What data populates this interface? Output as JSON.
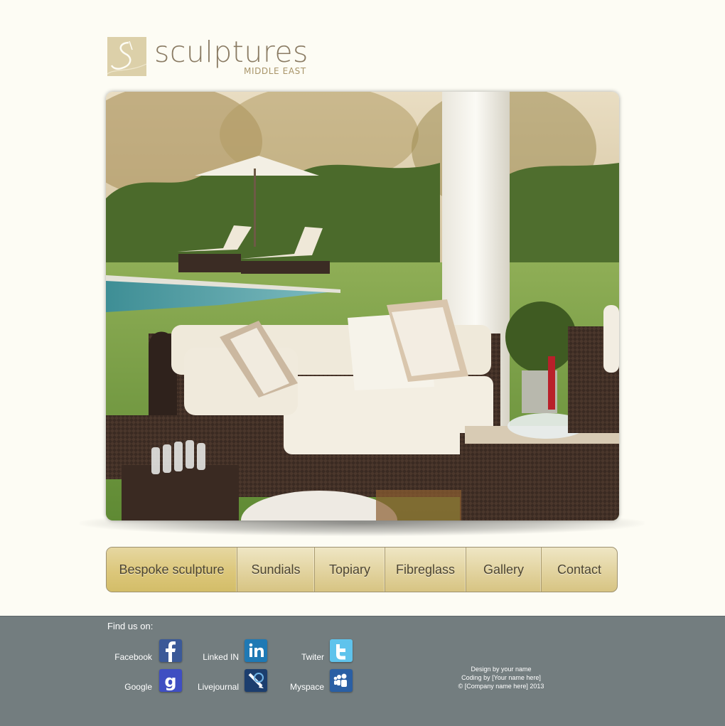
{
  "logo": {
    "word": "sculptures",
    "sub": "MIDDLE EAST"
  },
  "hero": {
    "image": "outdoor-patio-wicker-sofa-photo"
  },
  "nav": {
    "items": [
      {
        "label": "Bespoke sculpture"
      },
      {
        "label": "Sundials"
      },
      {
        "label": "Topiary"
      },
      {
        "label": "Fibreglass"
      },
      {
        "label": "Gallery"
      },
      {
        "label": "Contact"
      }
    ]
  },
  "footer": {
    "find_us": "Find us on:",
    "social": [
      {
        "label": "Facebook",
        "icon": "facebook-icon"
      },
      {
        "label": "Linked IN",
        "icon": "linkedin-icon"
      },
      {
        "label": "Twiter",
        "icon": "twitter-icon"
      },
      {
        "label": "Google",
        "icon": "google-icon"
      },
      {
        "label": "Livejournal",
        "icon": "livejournal-icon"
      },
      {
        "label": "Myspace",
        "icon": "myspace-icon"
      }
    ],
    "credits": {
      "line1": "Design by  your name",
      "line2": "Coding by [Your name here]",
      "line3": "© [Company name here] 2013"
    }
  },
  "colors": {
    "page_bg": "#fdfcf4",
    "footer_bg": "#737d7f",
    "nav_gold": "#dcc77b",
    "logo_tan": "#dcd0a9"
  }
}
